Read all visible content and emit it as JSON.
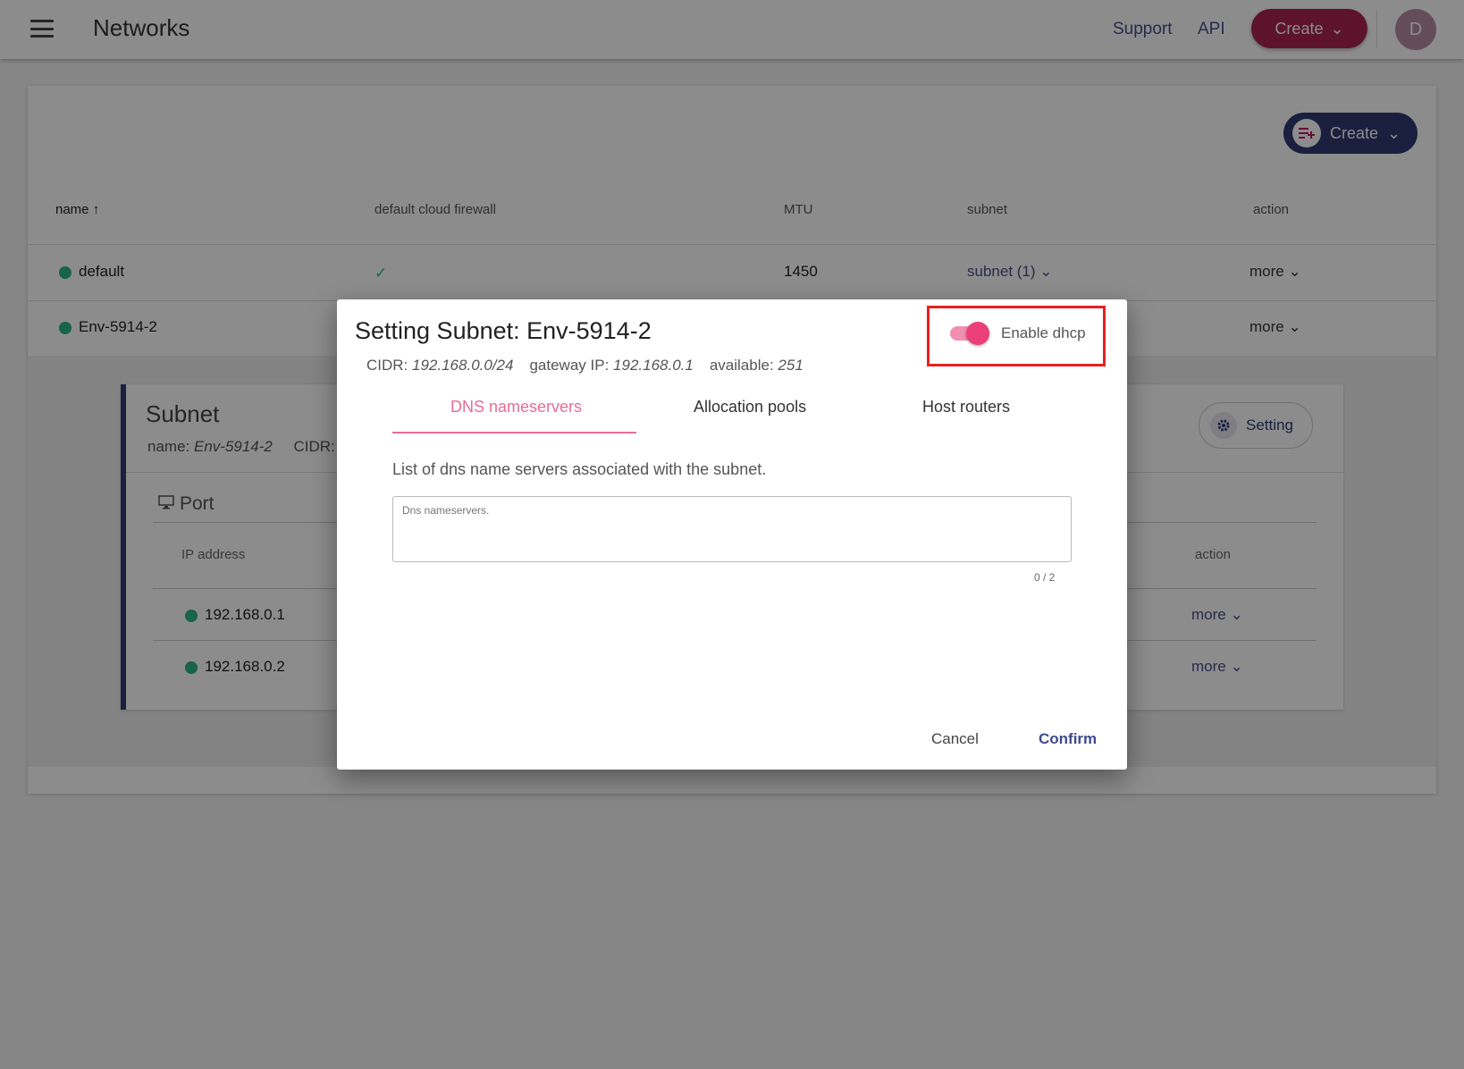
{
  "header": {
    "title": "Networks",
    "support": "Support",
    "api": "API",
    "create": "Create",
    "avatar": "D"
  },
  "card": {
    "create": "Create",
    "columns": [
      "name",
      "default cloud firewall",
      "MTU",
      "subnet",
      "action"
    ],
    "rows": [
      {
        "name": "default",
        "firewall": "✓",
        "mtu": "1450",
        "subnet": "subnet (1)",
        "action": "more"
      },
      {
        "name": "Env-5914-2",
        "firewall": "",
        "mtu": "",
        "subnet": "",
        "action": "more"
      }
    ]
  },
  "subnet_panel": {
    "title": "Subnet",
    "name_label": "name:",
    "name_value": "Env-5914-2",
    "cidr_label": "CIDR:",
    "setting": "Setting",
    "port_title": "Port",
    "columns": [
      "IP address",
      "action"
    ],
    "rows": [
      {
        "ip": "192.168.0.1",
        "action": "more"
      },
      {
        "ip": "192.168.0.2",
        "action": "more"
      }
    ]
  },
  "dialog": {
    "title": "Setting Subnet: Env-5914-2",
    "cidr_label": "CIDR:",
    "cidr_value": "192.168.0.0/24",
    "gateway_label": "gateway IP:",
    "gateway_value": "192.168.0.1",
    "available_label": "available:",
    "available_value": "251",
    "dhcp_label": "Enable dhcp",
    "dhcp_enabled": true,
    "tabs": [
      "DNS nameservers",
      "Allocation pools",
      "Host routers"
    ],
    "description": "List of dns name servers associated with the subnet.",
    "textarea_placeholder": "Dns nameservers.",
    "counter": "0 / 2",
    "cancel": "Cancel",
    "confirm": "Confirm"
  },
  "colors": {
    "accent_pink": "#e86c98",
    "navy": "#2e3a70",
    "status_green": "#2bb58a",
    "highlight_red": "#e8201e"
  }
}
